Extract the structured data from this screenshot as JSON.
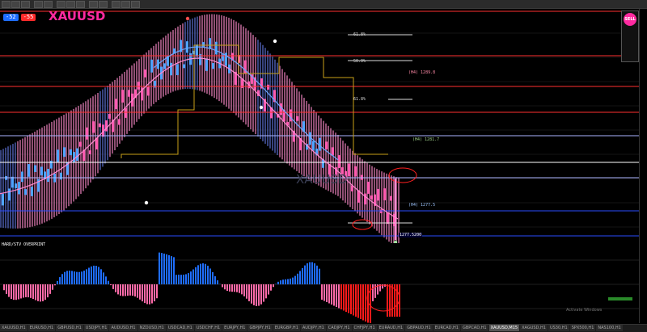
{
  "symbol": "XAUUSD",
  "watermark": "XAUUSD",
  "badge": {
    "left": "-52",
    "right": "-55"
  },
  "indicator_title": "HARD/STV OVERPRINT",
  "price_tag": "1277.5200",
  "level_labels": [
    "(H4) 1281.7",
    "(H4) 1277.5",
    "(H4) 1289.8",
    "61.8%",
    "50.0%",
    "61.8%"
  ],
  "activate_text": "Activate Windows",
  "tabs": [
    "XAUUSD,H1",
    "EURUSD,H1",
    "GBPUSD,H1",
    "USDJPY,H1",
    "AUDUSD,H1",
    "NZDUSD,H1",
    "USDCAD,H1",
    "USDCHF,H1",
    "EURJPY,H1",
    "GBPJPY,H1",
    "EURGBP,H1",
    "AUDJPY,H1",
    "CADJPY,H1",
    "CHFJPY,H1",
    "EURAUD,H1",
    "GBPAUD,H1",
    "EURCAD,H1",
    "GBPCAD,H1",
    "XAUUSD,M15",
    "XAGUSD,H1",
    "US30,H1",
    "SPX500,H1",
    "NAS100,H1"
  ],
  "active_tab": 18,
  "colors": {
    "band_pink": "#c06a9a",
    "band_blue": "#4a5aa8",
    "up": "#4fa3ff",
    "down": "#ff5ab0",
    "hist_blue": "#1f6dff",
    "hist_pink": "#ff6aa8",
    "hist_red": "#ff1a1a"
  }
}
